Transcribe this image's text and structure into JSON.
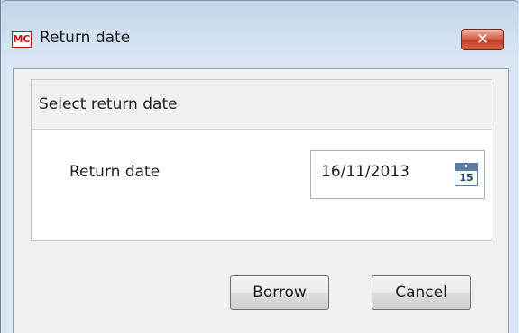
{
  "window": {
    "title": "Return date",
    "logo_text": "MC",
    "close_glyph": "✕"
  },
  "group": {
    "header": "Select return date",
    "field_label": "Return date",
    "date_value": "16/11/2013",
    "calendar_day": "15"
  },
  "buttons": {
    "borrow": "Borrow",
    "cancel": "Cancel"
  },
  "icons": {
    "app_logo": "mc-logo-icon",
    "close": "close-icon",
    "calendar": "calendar-icon"
  },
  "colors": {
    "close_button": "#d04a30",
    "title_gradient_top": "#c3d5ea",
    "dialog_body": "#f0f0f0",
    "calendar_accent": "#5b7ca3"
  }
}
